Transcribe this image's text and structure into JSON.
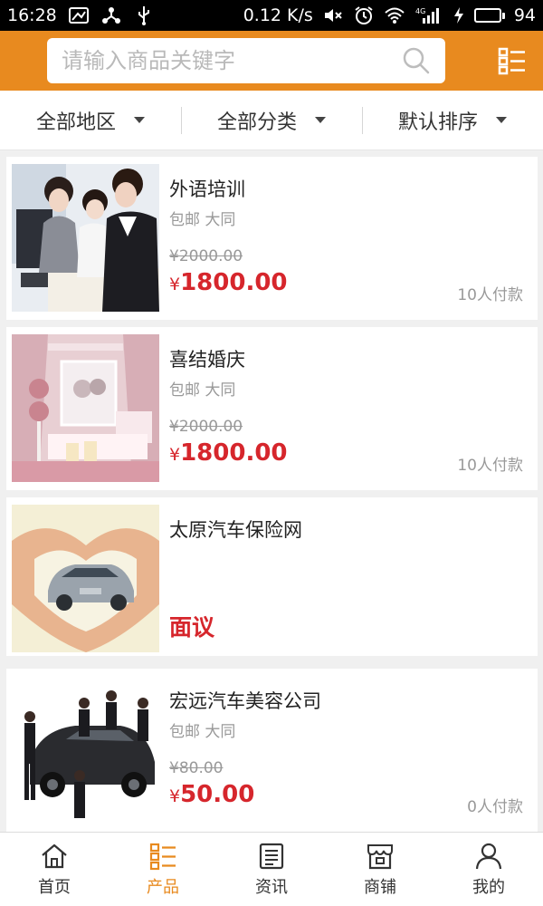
{
  "status_bar": {
    "time": "16:28",
    "net_speed": "0.12 K/s",
    "battery": "94",
    "signal_label": "4G"
  },
  "search": {
    "placeholder": "请输入商品关键字"
  },
  "filters": [
    {
      "label": "全部地区"
    },
    {
      "label": "全部分类"
    },
    {
      "label": "默认排序"
    }
  ],
  "products": [
    {
      "name": "外语培训",
      "ship": "包邮 大同",
      "old_price": "¥2000.00",
      "currency": "¥",
      "price": "1800.00",
      "paid": "10人付款"
    },
    {
      "name": "喜结婚庆",
      "ship": "包邮 大同",
      "old_price": "¥2000.00",
      "currency": "¥",
      "price": "1800.00",
      "paid": "10人付款"
    },
    {
      "name": "太原汽车保险网",
      "negotiable": "面议"
    },
    {
      "name": "宏远汽车美容公司",
      "ship": "包邮 大同",
      "old_price": "¥80.00",
      "currency": "¥",
      "price": "50.00",
      "paid": "0人付款"
    }
  ],
  "tabbar": [
    {
      "label": "首页",
      "icon": "home-icon"
    },
    {
      "label": "产品",
      "icon": "list-icon",
      "active": true
    },
    {
      "label": "资讯",
      "icon": "news-icon"
    },
    {
      "label": "商铺",
      "icon": "shop-icon"
    },
    {
      "label": "我的",
      "icon": "user-icon"
    }
  ],
  "colors": {
    "accent": "#e88a1f",
    "price_red": "#d6262c",
    "status_bar": "#000000",
    "battery_green": "#39d353"
  }
}
